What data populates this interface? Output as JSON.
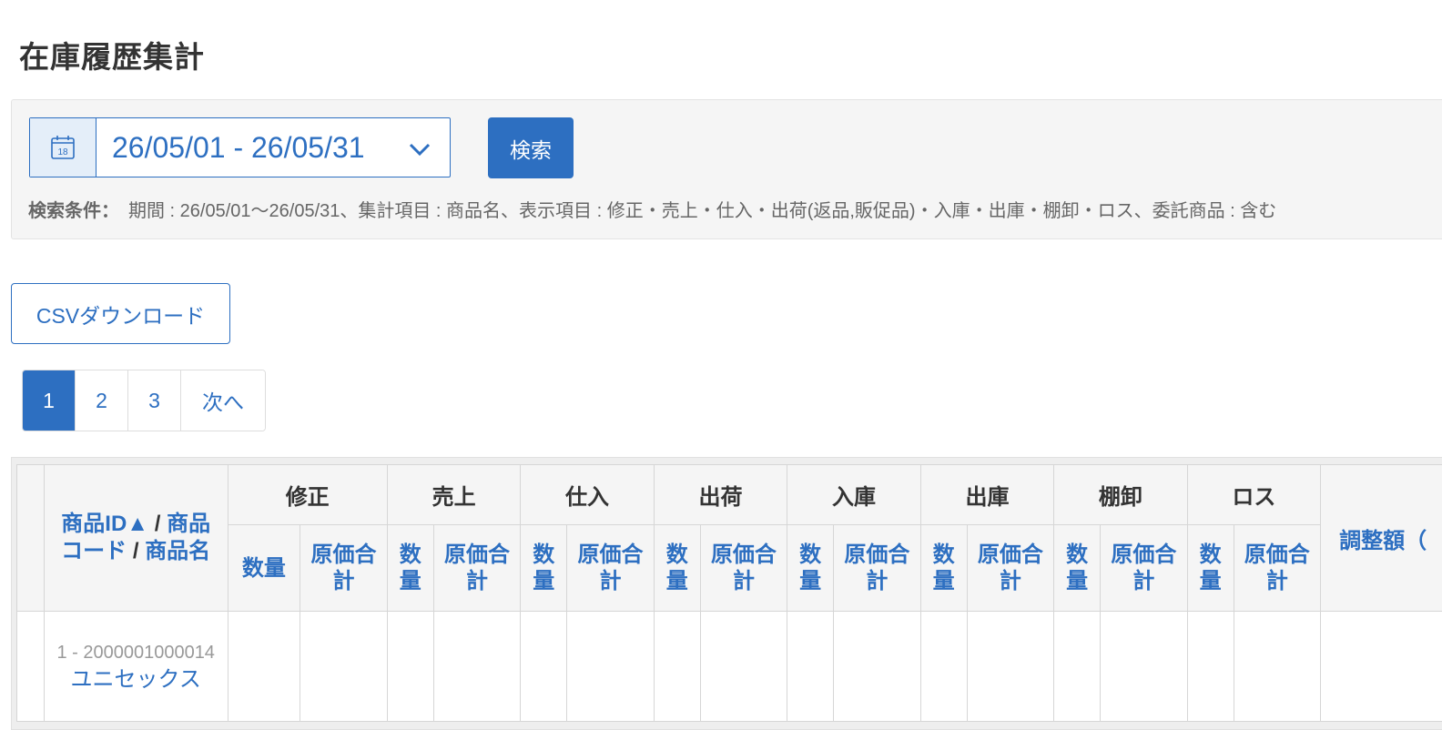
{
  "page": {
    "title": "在庫履歴集計"
  },
  "search": {
    "date_range": "26/05/01 - 26/05/31",
    "button": "検索",
    "conditions_label": "検索条件：",
    "conditions_text": "期間 : 26/05/01〜26/05/31、集計項目 : 商品名、表示項目 : 修正・売上・仕入・出荷(返品,販促品)・入庫・出庫・棚卸・ロス、委託商品 : 含む"
  },
  "actions": {
    "csv_button": "CSVダウンロード"
  },
  "pagination": {
    "pages": [
      "1",
      "2",
      "3"
    ],
    "active": "1",
    "next": "次へ"
  },
  "table": {
    "product_header": {
      "id": "商品ID▲",
      "sep1": " / ",
      "code1": "商品",
      "code2": "コード",
      "sep2": " / ",
      "name": "商品名"
    },
    "groups": [
      "修正",
      "売上",
      "仕入",
      "出荷",
      "入庫",
      "出庫",
      "棚卸",
      "ロス"
    ],
    "sub_quantity_wide": "数量",
    "sub_quantity_narrow": [
      "数",
      "量"
    ],
    "sub_cost": [
      "原価合",
      "計"
    ],
    "adjustment_header": "調整額（",
    "rows": [
      {
        "id_code": "1 - 2000001000014",
        "name": "ユニセックス"
      }
    ]
  },
  "colors": {
    "accent": "#2d6fc1",
    "panel_bg": "#f5f5f5"
  },
  "icons": {
    "calendar": "calendar-icon",
    "dropdown": "chevron-down-icon"
  }
}
